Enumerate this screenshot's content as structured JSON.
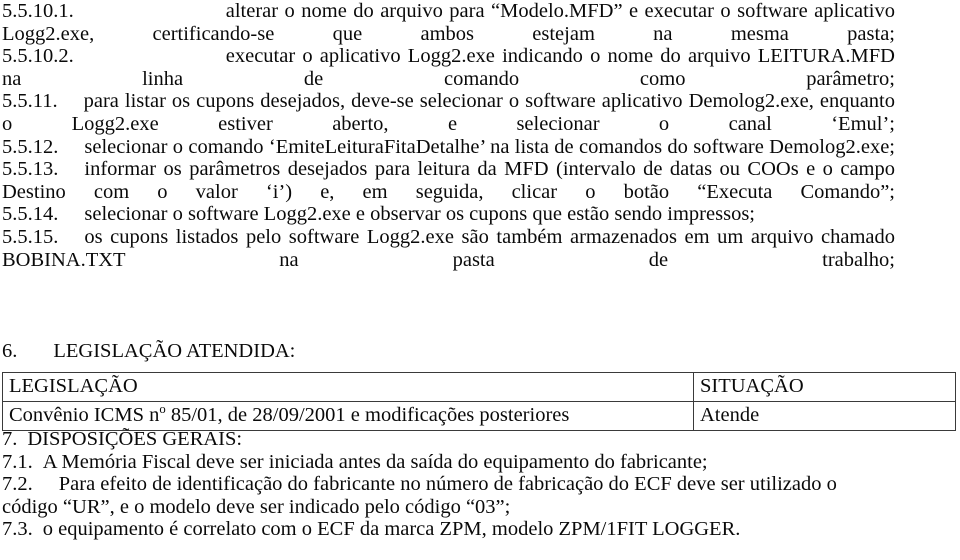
{
  "document": {
    "language": "pt-BR",
    "paragraphs": [
      {
        "id": "p_5_5_10_1",
        "number": "5.5.10.1.",
        "indent": "wide",
        "text": "alterar o nome do arquivo para “Modelo.MFD” e executar o software aplicativo Logg2.exe, certificando-se que ambos estejam na mesma pasta;"
      },
      {
        "id": "p_5_5_10_2",
        "number": "5.5.10.2.",
        "indent": "wide",
        "text": "executar o aplicativo Logg2.exe indicando o nome do arquivo LEITURA.MFD na linha de comando como parâmetro;"
      },
      {
        "id": "p_5_5_11",
        "number": "5.5.11.",
        "indent": "small",
        "text": "para listar os cupons desejados, deve-se selecionar o software aplicativo Demolog2.exe, enquanto o Logg2.exe estiver aberto, e selecionar o canal ‘Emul’;"
      },
      {
        "id": "p_5_5_12",
        "number": "5.5.12.",
        "indent": "small",
        "text": "selecionar o comando ‘EmiteLeituraFitaDetalhe’ na lista de comandos do software Demolog2.exe;"
      },
      {
        "id": "p_5_5_13",
        "number": "5.5.13.",
        "indent": "small",
        "text": "informar os parâmetros desejados para leitura da MFD (intervalo de datas ou COOs e o campo Destino com o valor ‘i’) e, em seguida, clicar o botão “Executa Comando”;"
      },
      {
        "id": "p_5_5_14",
        "number": "5.5.14.",
        "indent": "small",
        "text": "selecionar o software Logg2.exe e observar os cupons que estão sendo impressos;"
      },
      {
        "id": "p_5_5_15",
        "number": "5.5.15.",
        "indent": "small",
        "text": "os cupons listados pelo software Logg2.exe são também armazenados em um arquivo chamado BOBINA.TXT na pasta de trabalho;"
      }
    ],
    "section6": {
      "number": "6.",
      "title": "LEGISLAÇÃO ATENDIDA:"
    },
    "legislation_table": {
      "columns": [
        "LEGISLAÇÃO",
        "SITUAÇÃO"
      ],
      "rows": [
        {
          "legislacao_prefix": "Convênio ICMS n",
          "legislacao_sup": "o",
          "legislacao_suffix": " 85/01, de 28/09/2001 e modificações posteriores",
          "situacao": "Atende"
        }
      ]
    },
    "section7": {
      "number": "7.",
      "title": "DISPOSIÇÕES GERAIS:",
      "items": [
        {
          "id": "p_7_1",
          "number": "7.1.",
          "text": "A Memória Fiscal deve ser iniciada antes da saída do equipamento do fabricante;"
        },
        {
          "id": "p_7_2",
          "number": "7.2.",
          "text": "Para efeito de identificação do fabricante no número de fabricação do ECF deve ser utilizado o código “UR”, e o modelo deve ser indicado pelo código “03”;"
        },
        {
          "id": "p_7_3",
          "number": "7.3.",
          "text": "o equipamento é correlato com o ECF da marca ZPM, modelo ZPM/1FIT LOGGER."
        }
      ]
    }
  },
  "colors": {
    "page_background": "#ffffff",
    "text": "#0a0a0a",
    "table_border": "#3a3a3a"
  }
}
